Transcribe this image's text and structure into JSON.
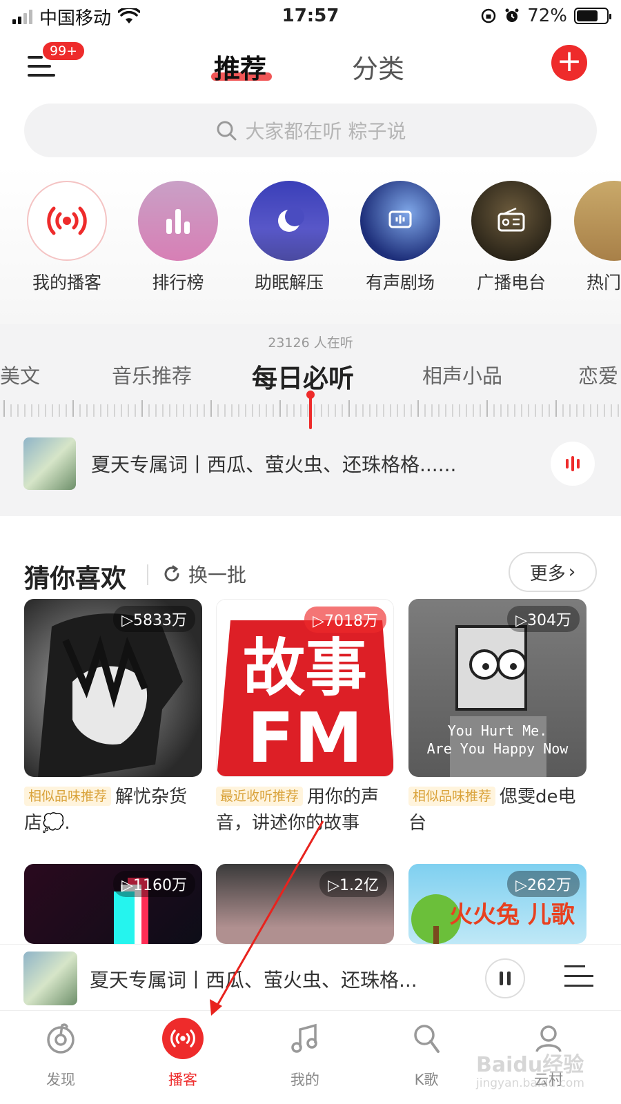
{
  "status_bar": {
    "carrier": "中国移动",
    "time": "17:57",
    "battery_percent": "72%",
    "battery_level": 0.72
  },
  "header": {
    "menu_badge": "99+",
    "tab_recommend": "推荐",
    "tab_category": "分类",
    "add_icon": "plus-icon"
  },
  "search": {
    "placeholder": "大家都在听 粽子说"
  },
  "categories": [
    {
      "label": "我的播客",
      "icon": "broadcast-icon"
    },
    {
      "label": "排行榜",
      "icon": "chart-icon"
    },
    {
      "label": "助眠解压",
      "icon": "moon-icon"
    },
    {
      "label": "有声剧场",
      "icon": "theater-icon"
    },
    {
      "label": "广播电台",
      "icon": "radio-icon"
    },
    {
      "label": "热门",
      "icon": "hot-icon"
    }
  ],
  "dial": {
    "listeners": "23126 人在听",
    "channels": [
      "美文",
      "音乐推荐",
      "每日必听",
      "相声小品",
      "恋爱"
    ],
    "active_channel": "每日必听",
    "now_playing": "夏天专属词丨西瓜、萤火虫、还珠格格......"
  },
  "guess": {
    "title": "猜你喜欢",
    "refresh": "换一批",
    "more": "更多",
    "cards": [
      {
        "plays": "▷5833万",
        "tag": "相似品味推荐",
        "title": "解忧杂货店💭."
      },
      {
        "plays": "▷7018万",
        "tag": "最近收听推荐",
        "title": "用你的声音，讲述你的故事"
      },
      {
        "plays": "▷304万",
        "tag": "相似品味推荐",
        "title": "偲雯de电台"
      },
      {
        "plays": "▷1160万",
        "tag": "",
        "title": ""
      },
      {
        "plays": "▷1.2亿",
        "tag": "",
        "title": ""
      },
      {
        "plays": "▷262万",
        "tag": "",
        "title": ""
      }
    ],
    "card_art_text": {
      "story_fm_top": "故事",
      "story_fm_bottom": "FM",
      "bart_line1": "You Hurt Me.",
      "bart_line2": "Are You Happy Now",
      "kids_song": "火火兔 儿歌"
    }
  },
  "mini_player": {
    "title": "夏天专属词丨西瓜、萤火虫、还珠格..."
  },
  "bottom_nav": [
    {
      "label": "发现",
      "icon": "discover-icon"
    },
    {
      "label": "播客",
      "icon": "podcast-icon"
    },
    {
      "label": "我的",
      "icon": "music-note-icon"
    },
    {
      "label": "K歌",
      "icon": "microphone-icon"
    },
    {
      "label": "云村",
      "icon": "community-icon"
    }
  ],
  "watermark": {
    "main": "Baidu经验",
    "sub": "jingyan.baidu.com"
  },
  "colors": {
    "accent": "#ee2b2b",
    "tag_bg": "#fff4dd",
    "tag_text": "#d9a23a"
  }
}
